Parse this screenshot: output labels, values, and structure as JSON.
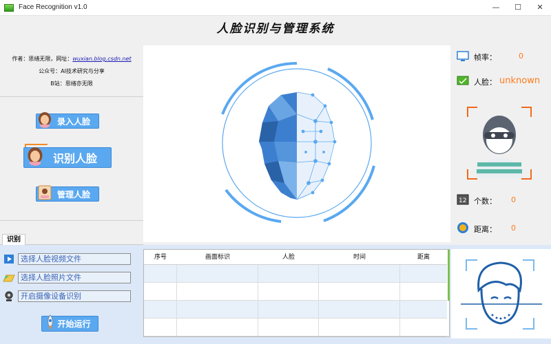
{
  "window": {
    "title": "Face Recognition v1.0"
  },
  "header": {
    "title": "人脸识别与管理系统"
  },
  "info": {
    "author_label": "作者：思绪无限，网址：",
    "author_link": "wuxian.blog.csdn.net",
    "wechat": "公众号：AI技术研究与分享",
    "bilibili": "B站：思绪亦无限"
  },
  "actions": {
    "enroll": "录入人脸",
    "recognize": "识别人脸",
    "manage": "管理人脸"
  },
  "stats": {
    "fps_label": "帧率：",
    "fps_value": "0",
    "face_label": "人脸：",
    "face_value": "unknown",
    "count_label": "个数：",
    "count_value": "0",
    "distance_label": "距离：",
    "distance_value": "0"
  },
  "tab": {
    "label": "识别"
  },
  "options": {
    "video": "选择人脸视频文件",
    "photo": "选择人脸照片文件",
    "camera": "开启摄像设备识别",
    "run": "开始运行"
  },
  "table": {
    "columns": [
      "序号",
      "画面标识",
      "人脸",
      "时间",
      "距离"
    ]
  },
  "colors": {
    "button": "#5aa8f0",
    "accent_orange": "#ff7a1a",
    "bottom_bg": "#dce8f7",
    "face_blue": "#3d7fcf"
  }
}
